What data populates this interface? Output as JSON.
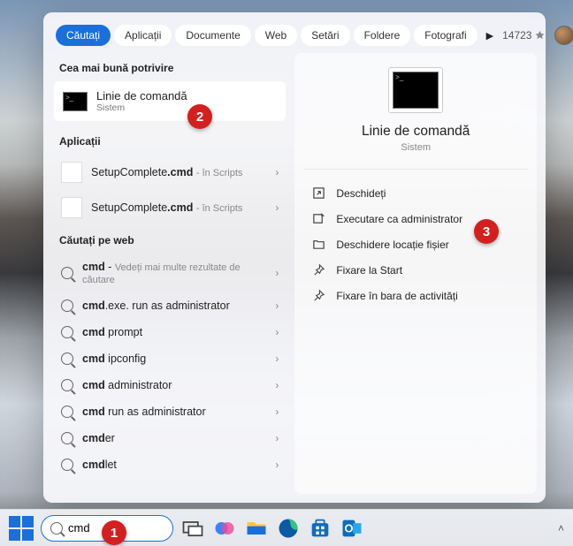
{
  "tabs": {
    "items": [
      "Căutați",
      "Aplicații",
      "Documente",
      "Web",
      "Setări",
      "Foldere",
      "Fotografi"
    ],
    "activeIndex": 0
  },
  "points": "14723",
  "sections": {
    "best": "Cea mai bună potrivire",
    "apps": "Aplicații",
    "web": "Căutați pe web"
  },
  "bestMatch": {
    "title": "Linie de comandă",
    "subtitle": "Sistem"
  },
  "apps": [
    {
      "name": "SetupComplete",
      "ext": ".cmd",
      "hint": "- în Scripts"
    },
    {
      "name": "SetupComplete",
      "ext": ".cmd",
      "hint": "- în Scripts"
    }
  ],
  "web": [
    {
      "q": "cmd",
      "suffix": "",
      "hint": "Vedeți mai multe rezultate de căutare"
    },
    {
      "q": "cmd",
      "suffix": ".exe. run as administrator",
      "hint": ""
    },
    {
      "q": "cmd",
      "suffix": " prompt",
      "hint": ""
    },
    {
      "q": "cmd",
      "suffix": " ipconfig",
      "hint": ""
    },
    {
      "q": "cmd",
      "suffix": " administrator",
      "hint": ""
    },
    {
      "q": "cmd",
      "suffix": " run as administrator",
      "hint": ""
    },
    {
      "q": "cmd",
      "suffix": "er",
      "hint": ""
    },
    {
      "q": "cmd",
      "suffix": "let",
      "hint": ""
    }
  ],
  "preview": {
    "title": "Linie de comandă",
    "subtitle": "Sistem",
    "actions": [
      {
        "icon": "open",
        "label": "Deschideți"
      },
      {
        "icon": "admin",
        "label": "Executare ca administrator"
      },
      {
        "icon": "folder",
        "label": "Deschidere locație fișier"
      },
      {
        "icon": "pin",
        "label": "Fixare la Start"
      },
      {
        "icon": "pin",
        "label": "Fixare în bara de activități"
      }
    ]
  },
  "search": {
    "value": "cmd",
    "placeholder": "Căutați"
  },
  "callouts": {
    "1": "1",
    "2": "2",
    "3": "3"
  }
}
